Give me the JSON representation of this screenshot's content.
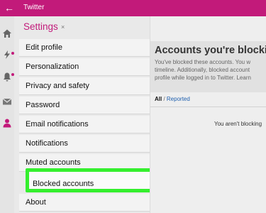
{
  "window": {
    "title": "Twitter"
  },
  "settings": {
    "title": "Settings",
    "menu": [
      "Edit profile",
      "Personalization",
      "Privacy and safety",
      "Password",
      "Email notifications",
      "Notifications",
      "Muted accounts",
      "Blocked accounts",
      "About"
    ],
    "selected": "Blocked accounts"
  },
  "content": {
    "title": "Accounts you're blocking",
    "desc_line1": "You've blocked these accounts. You w",
    "desc_line2": "timeline. Additionally, blocked account",
    "desc_line3": "profile while logged in to Twitter. Learn",
    "filter_all": "All",
    "filter_sep": " / ",
    "filter_reported": "Reported",
    "empty": "You aren't blocking"
  },
  "colors": {
    "accent": "#c21a7a",
    "highlight": "#35ef2e"
  },
  "icons": [
    "back-arrow-icon",
    "home-icon",
    "lightning-icon",
    "bell-icon",
    "mail-icon",
    "person-icon",
    "close-icon"
  ]
}
